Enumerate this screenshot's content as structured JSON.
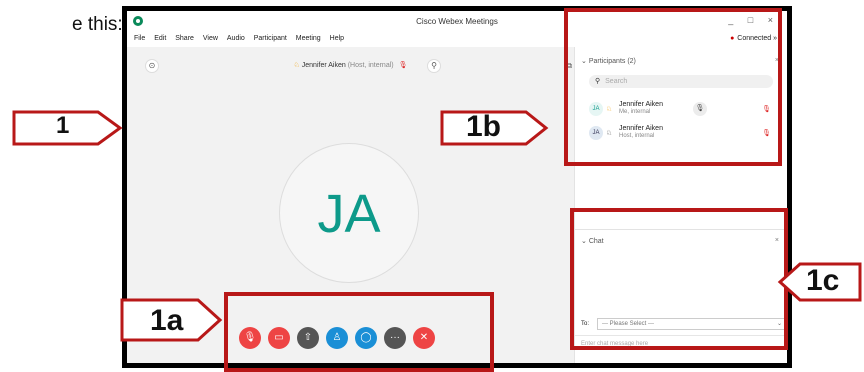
{
  "caption_text": "e this:",
  "window": {
    "title": "Cisco Webex Meetings",
    "controls": "_ □ ×"
  },
  "menu": [
    "File",
    "Edit",
    "Share",
    "View",
    "Audio",
    "Participant",
    "Meeting",
    "Help"
  ],
  "connection": {
    "status": "Connected"
  },
  "stage": {
    "speaker_name": "Jennifer Aiken",
    "speaker_role": "(Host, internal)",
    "avatar_initials": "JA"
  },
  "participants": {
    "header": "Participants (2)",
    "search_placeholder": "Search",
    "items": [
      {
        "initials": "JA",
        "name": "Jennifer Aiken",
        "sub": "Me, internal"
      },
      {
        "initials": "JA",
        "name": "Jennifer Aiken",
        "sub": "Host, internal"
      }
    ]
  },
  "chat": {
    "header": "Chat",
    "to_label": "To:",
    "select_value": "--- Please Select ---",
    "message_placeholder": "Enter chat message here"
  },
  "labels": {
    "l1": "1",
    "l1a": "1a",
    "l1b": "1b",
    "l1c": "1c"
  },
  "colors": {
    "highlight": "#b81818",
    "accent": "#0d9a8a",
    "mute_red": "#ee4444",
    "blue": "#1a8fd6",
    "dark": "#555555"
  }
}
